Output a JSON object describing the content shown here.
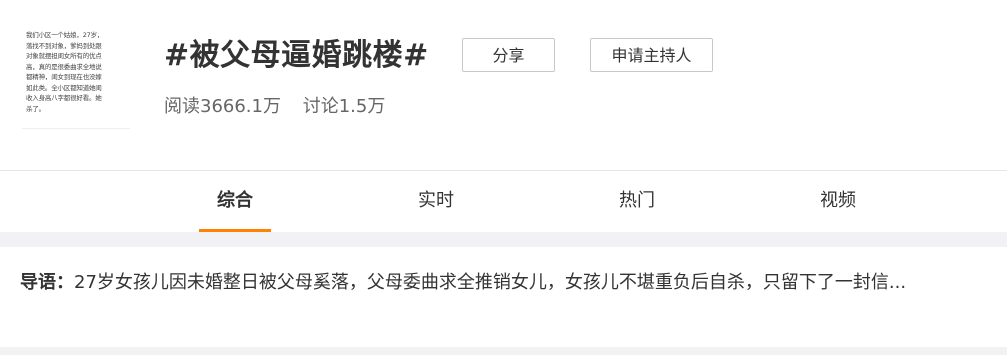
{
  "topic": {
    "title": "#被父母逼婚跳楼#",
    "thumbnail_lines": [
      "我们小区一个姑娘，27岁，",
      "落找不到对象，爹妈到处跟",
      "对象就摆担闺女所有的优点",
      "高，真的是很委曲求全地说",
      "都精神，闺女到现在也没嫁",
      "如此类。全小区都知道她闺",
      "收入身高八字都很好看。她",
      "杀了。"
    ],
    "share_label": "分享",
    "apply_host_label": "申请主持人",
    "stats": {
      "reads": "阅读3666.1万",
      "discussions": "讨论1.5万"
    }
  },
  "tabs": [
    {
      "label": "综合",
      "active": true
    },
    {
      "label": "实时",
      "active": false
    },
    {
      "label": "热门",
      "active": false
    },
    {
      "label": "视频",
      "active": false
    }
  ],
  "intro": {
    "label": "导语：",
    "text": "27岁女孩儿因未婚整日被父母奚落，父母委曲求全推销女儿，女孩儿不堪重负后自杀，只留下了一封信..."
  },
  "colors": {
    "accent": "#ff8200",
    "separator": "#f2f2f5"
  }
}
